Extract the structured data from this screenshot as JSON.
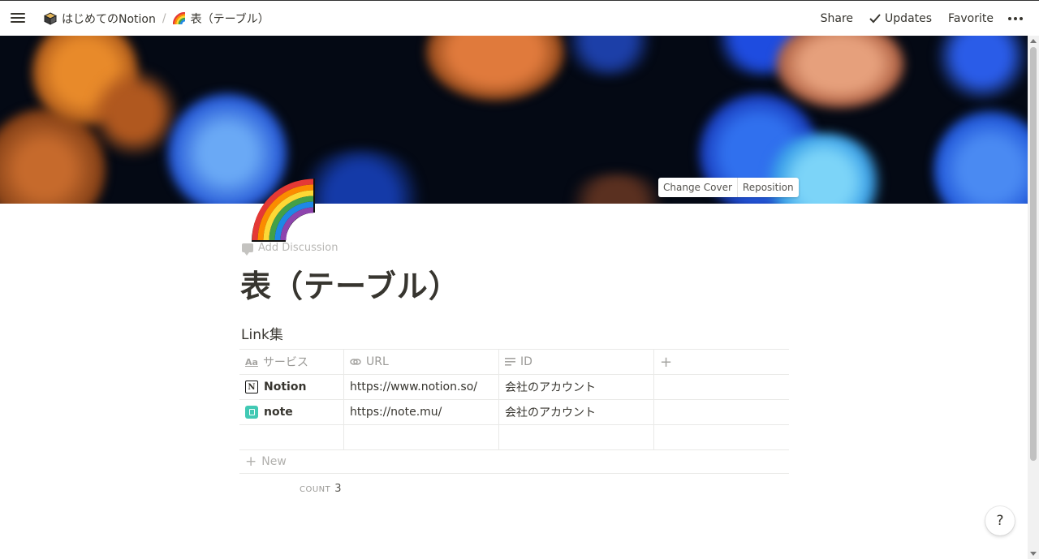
{
  "topbar": {
    "breadcrumbs": [
      {
        "label": "はじめてのNotion",
        "icon": "package-icon"
      },
      {
        "label": "表（テーブル）",
        "icon": "rainbow-icon"
      }
    ],
    "separator": "/",
    "share": "Share",
    "updates": "Updates",
    "favorite": "Favorite"
  },
  "cover": {
    "change_cover": "Change Cover",
    "reposition": "Reposition"
  },
  "page": {
    "icon": "rainbow-icon",
    "add_discussion": "Add Discussion",
    "title": "表（テーブル）"
  },
  "database": {
    "title": "Link集",
    "columns": [
      {
        "label": "サービス",
        "icon": "title-aa-icon"
      },
      {
        "label": "URL",
        "icon": "link-icon"
      },
      {
        "label": "ID",
        "icon": "text-lines-icon"
      }
    ],
    "rows": [
      {
        "name": "Notion",
        "icon": "notion-logo-icon",
        "url": "https://www.notion.so/",
        "id": "会社のアカウント"
      },
      {
        "name": "note",
        "icon": "note-logo-icon",
        "url": "https://note.mu/",
        "id": "会社のアカウント"
      },
      {
        "name": "",
        "icon": "",
        "url": "",
        "id": ""
      }
    ],
    "new_label": "New",
    "count_label": "COUNT",
    "count_value": "3"
  },
  "help": "?",
  "colors": {
    "text": "#37352f",
    "muted": "#9b9a97",
    "note_brand": "#41c9b4"
  }
}
